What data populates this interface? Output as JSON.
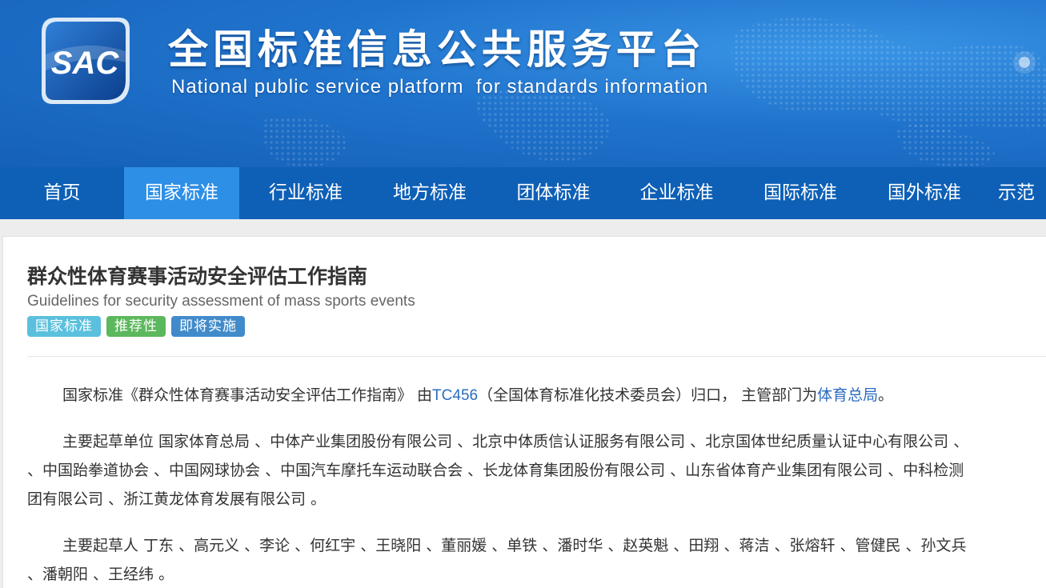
{
  "header": {
    "logo_text": "SAC",
    "site_title": "全国标准信息公共服务平台",
    "site_subtitle": "National public service platform  for standards information"
  },
  "nav": {
    "items": [
      {
        "label": "首页"
      },
      {
        "label": "国家标准",
        "active": true
      },
      {
        "label": "行业标准"
      },
      {
        "label": "地方标准"
      },
      {
        "label": "团体标准"
      },
      {
        "label": "企业标准"
      },
      {
        "label": "国际标准"
      },
      {
        "label": "国外标准"
      },
      {
        "label": "示范"
      }
    ]
  },
  "standard": {
    "title": "群众性体育赛事活动安全评估工作指南",
    "title_en": "Guidelines for security assessment of mass sports events",
    "tags": [
      "国家标准",
      "推荐性",
      "即将实施"
    ]
  },
  "intro": {
    "prefix": "国家标准《群众性体育赛事活动安全评估工作指南》 由",
    "tc_link": "TC456",
    "middle": "（全国体育标准化技术委员会）归口， 主管部门为",
    "dept_link": "体育总局",
    "suffix": "。"
  },
  "drafting_units": {
    "line1": "主要起草单位 国家体育总局 、中体产业集团股份有限公司 、北京中体质信认证服务有限公司 、北京国体世纪质量认证中心有限公司 、",
    "line2": "、中国跆拳道协会 、中国网球协会 、中国汽车摩托车运动联合会 、长龙体育集团股份有限公司 、山东省体育产业集团有限公司 、中科检测",
    "line3": "团有限公司 、浙江黄龙体育发展有限公司 。"
  },
  "drafters": {
    "line1": "主要起草人 丁东 、高元义 、李论 、何红宇 、王晓阳 、董丽媛 、单铁 、潘时华 、赵英魁 、田翔 、蒋洁 、张熔轩 、管健民 、孙文兵",
    "line2": "、潘朝阳 、王经纬 。"
  },
  "colors": {
    "banner": "#1f73cc",
    "nav": "#0e60b6",
    "nav_active": "#2d8fe6",
    "link": "#2a6bbf",
    "tag_national": "#5bc0de",
    "tag_recommended": "#5cb85c",
    "tag_upcoming": "#428bca"
  }
}
